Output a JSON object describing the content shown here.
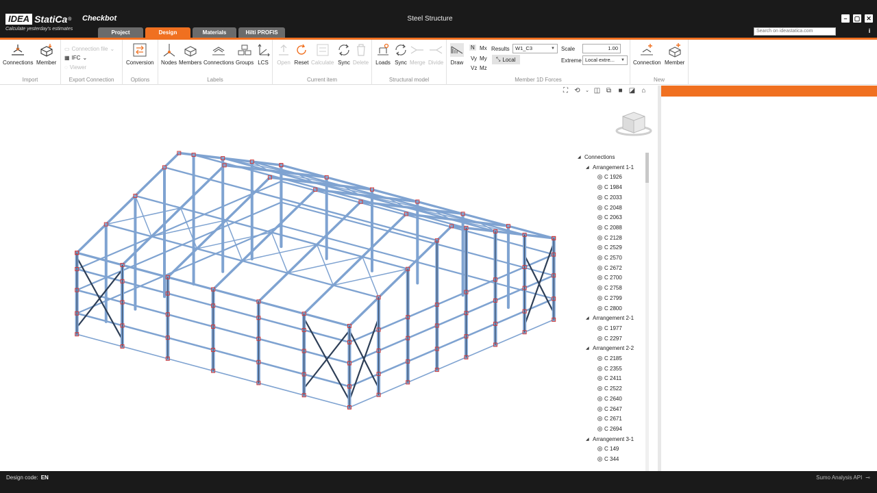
{
  "app": {
    "logo_left": "IDEA",
    "logo_right": "StatiCa",
    "logo_reg": "®",
    "tagline": "Calculate yesterday's estimates",
    "product": "Checkbot",
    "window_title": "Steel Structure",
    "search_placeholder": "Search on ideastatica.com",
    "info_icon": "i"
  },
  "tabs": [
    {
      "label": "Project",
      "active": false
    },
    {
      "label": "Design",
      "active": true
    },
    {
      "label": "Materials",
      "active": false
    },
    {
      "label": "Hilti PROFIS",
      "active": false
    }
  ],
  "ribbon": {
    "import": {
      "label": "Import",
      "connections": "Connections",
      "member": "Member"
    },
    "export": {
      "label": "Export Connection",
      "connection_file": "Connection file",
      "ifc": "IFC",
      "viewer": "Viewer"
    },
    "options": {
      "label": "Options",
      "conversion": "Conversion"
    },
    "labels": {
      "label": "Labels",
      "nodes": "Nodes",
      "members": "Members",
      "connections": "Connections",
      "groups": "Groups",
      "lcs": "LCS"
    },
    "current_item": {
      "label": "Current item",
      "open": "Open",
      "reset": "Reset",
      "calculate": "Calculate",
      "sync": "Sync",
      "delete": "Delete"
    },
    "structural_model": {
      "label": "Structural model",
      "loads": "Loads",
      "sync": "Sync",
      "merge": "Merge",
      "divide": "Divide"
    },
    "forces": {
      "label": "Member 1D Forces",
      "draw": "Draw",
      "n": "N",
      "vy": "Vy",
      "vz": "Vz",
      "mx": "Mx",
      "my": "My",
      "mz": "Mz",
      "results_label": "Results",
      "results_value": "W1_C3",
      "local": "Local",
      "scale_label": "Scale",
      "scale_value": "1.00",
      "extreme_label": "Extreme",
      "extreme_value": "Local extre..."
    },
    "new": {
      "label": "New",
      "connection": "Connection",
      "member": "Member"
    }
  },
  "tree": {
    "root": "Connections",
    "groups": [
      {
        "name": "Arrangement 1-1",
        "items": [
          "C 1926",
          "C 1984",
          "C 2033",
          "C 2048",
          "C 2063",
          "C 2088",
          "C 2128",
          "C 2529",
          "C 2570",
          "C 2672",
          "C 2700",
          "C 2758",
          "C 2799",
          "C 2800"
        ]
      },
      {
        "name": "Arrangement 2-1",
        "items": [
          "C 1977",
          "C 2297"
        ]
      },
      {
        "name": "Arrangement 2-2",
        "items": [
          "C 2185",
          "C 2355",
          "C 2411",
          "C 2522",
          "C 2640",
          "C 2647",
          "C 2671",
          "C 2694"
        ]
      },
      {
        "name": "Arrangement 3-1",
        "items": [
          "C 149",
          "C 344"
        ]
      }
    ]
  },
  "status": {
    "design_code_label": "Design code:",
    "design_code_value": "EN",
    "api": "Sumo Analysis API"
  },
  "colors": {
    "accent": "#f07020",
    "member": "#7fa3d1",
    "dark_member": "#2e3f57",
    "node": "#d03a3a"
  }
}
